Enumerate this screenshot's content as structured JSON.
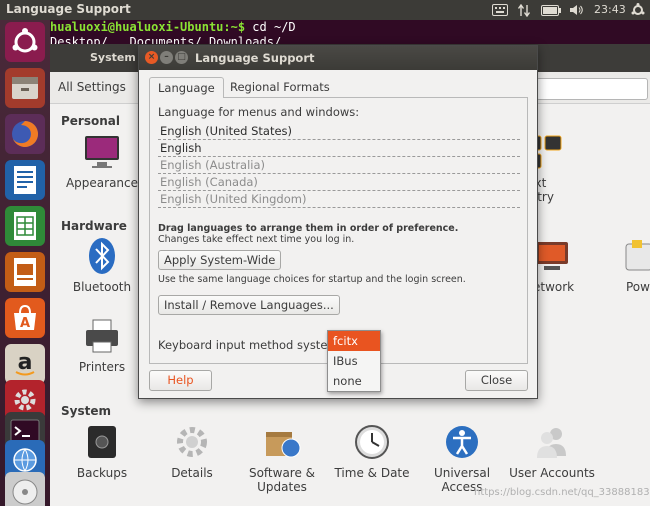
{
  "top_panel": {
    "title": "Language Support",
    "clock": "23:43",
    "tray_icons": [
      "keyboard-icon",
      "network-icon",
      "battery-icon",
      "volume-icon",
      "settings-icon"
    ]
  },
  "terminal": {
    "prompt": "hualuoxi@hualuoxi-Ubuntu:~$",
    "command": " cd ~/D",
    "completions": "Desktop/   Documents/ Downloads/"
  },
  "settings_window": {
    "title": "System Settings",
    "toolbar_label": "All Settings",
    "sections": {
      "personal": "Personal",
      "hardware": "Hardware",
      "system": "System"
    },
    "personal_items": [
      "Appearance",
      "Text Entry"
    ],
    "hardware_items": [
      "Bluetooth",
      "Network",
      "Power",
      "Printers"
    ],
    "system_items": [
      "Backups",
      "Details",
      "Software & Updates",
      "Time & Date",
      "Universal Access",
      "User Accounts"
    ]
  },
  "dialog": {
    "title": "Language Support",
    "tabs": [
      "Language",
      "Regional Formats"
    ],
    "heading": "Language for menus and windows:",
    "languages": [
      {
        "name": "English (United States)",
        "active": true
      },
      {
        "name": "English",
        "active": true
      },
      {
        "name": "English (Australia)",
        "active": false
      },
      {
        "name": "English (Canada)",
        "active": false
      },
      {
        "name": "English (United Kingdom)",
        "active": false
      }
    ],
    "drag_hint": "Drag languages to arrange them in order of preference.",
    "change_hint": "Changes take effect next time you log in.",
    "apply_button": "Apply System-Wide",
    "apply_hint": "Use the same language choices for startup and the login screen.",
    "install_button": "Install / Remove Languages...",
    "keyboard_label": "Keyboard input method system:",
    "keyboard_options": [
      "fcitx",
      "IBus",
      "none"
    ],
    "keyboard_selected": "fcitx",
    "help_button": "Help",
    "close_button": "Close"
  },
  "watermark": "https://blog.csdn.net/qq_33888183",
  "colors": {
    "accent": "#e95420",
    "panel": "#3c3b37",
    "terminal_bg": "#300a24"
  }
}
